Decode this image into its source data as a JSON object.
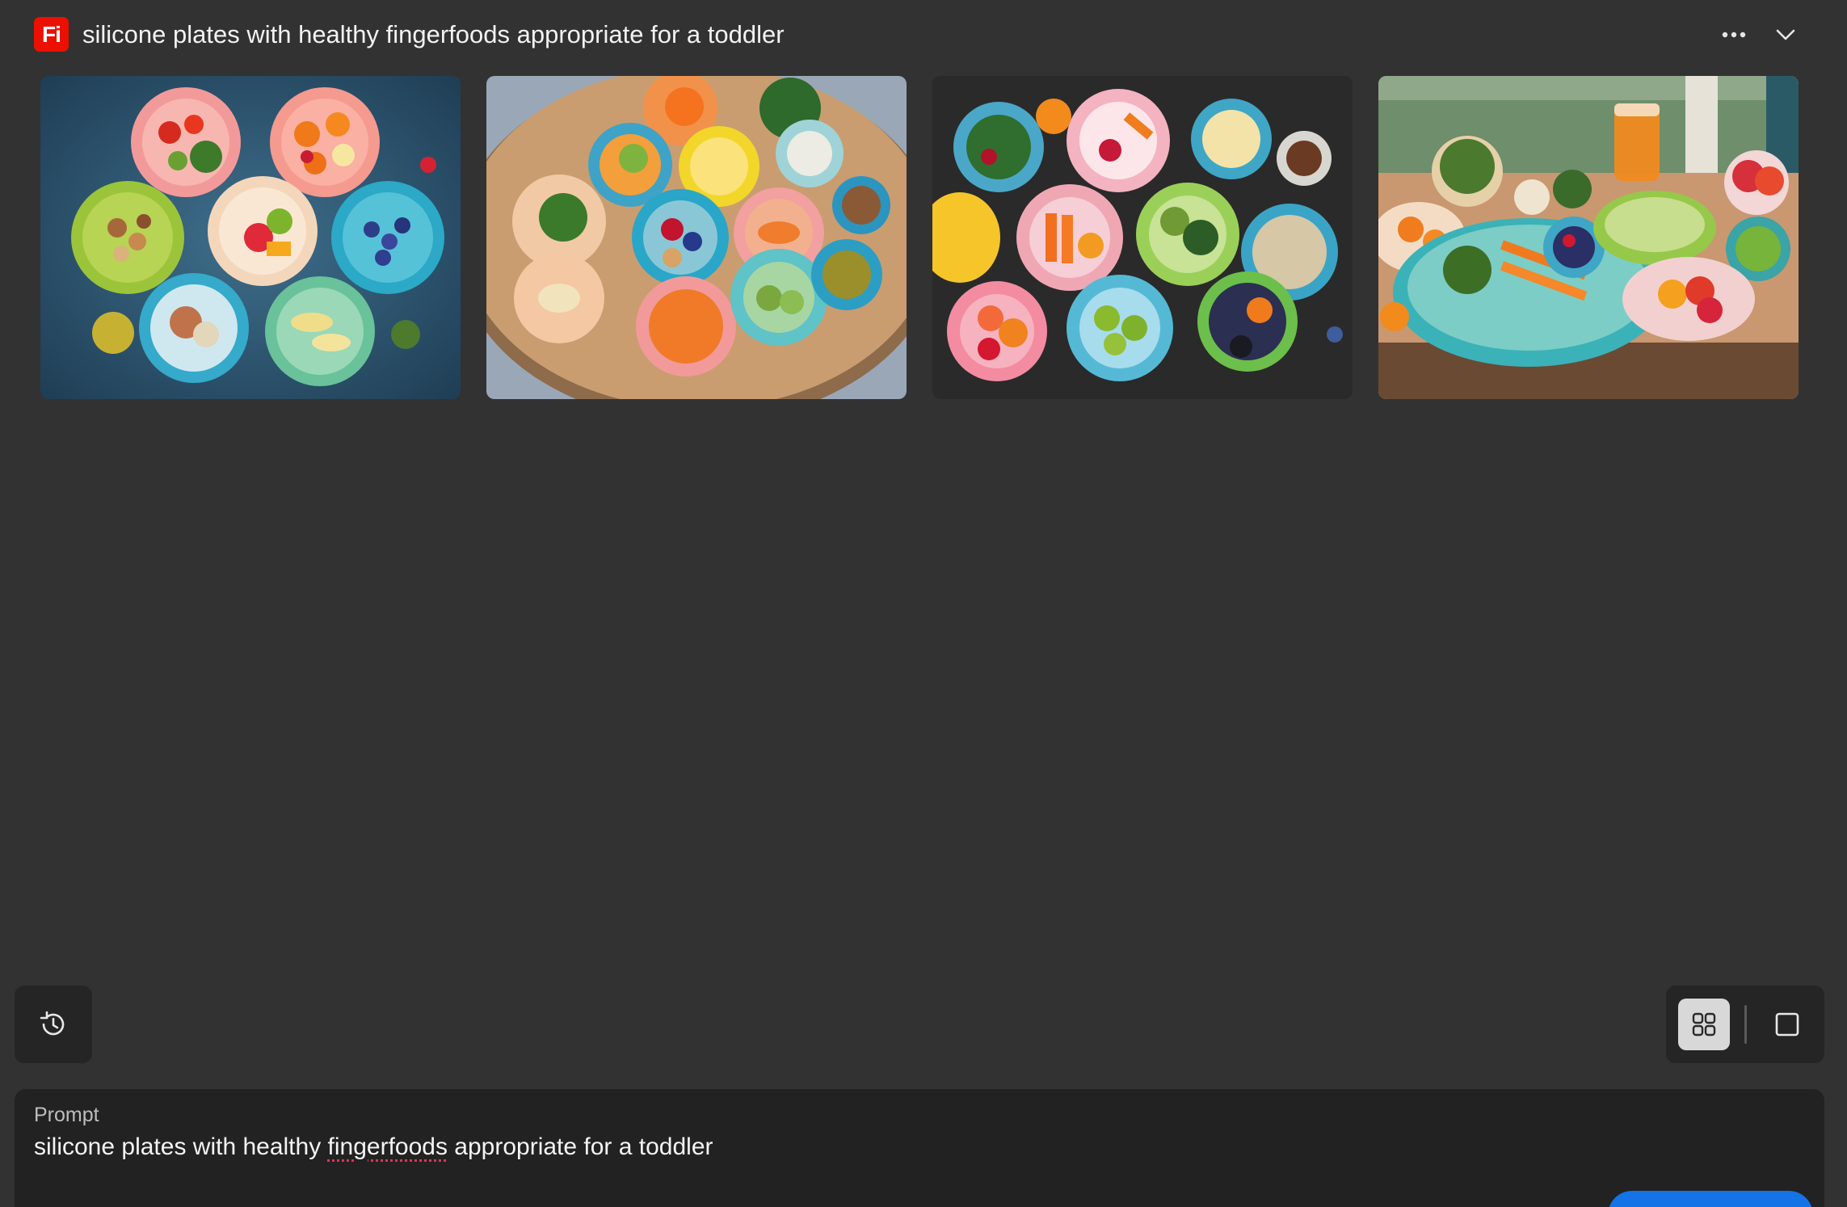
{
  "app": {
    "logo_text": "Fi",
    "title": "silicone plates with healthy fingerfoods appropriate for a toddler",
    "brand_color": "#eb1000"
  },
  "header": {
    "more_icon": "ellipsis-icon",
    "collapse_icon": "chevron-down-icon"
  },
  "results": {
    "images": [
      {
        "name": "result-image-1"
      },
      {
        "name": "result-image-2"
      },
      {
        "name": "result-image-3"
      },
      {
        "name": "result-image-4"
      }
    ]
  },
  "toolbar": {
    "history_icon": "history-icon",
    "view_grid_icon": "grid-view-icon",
    "view_single_icon": "single-view-icon",
    "active_view": "grid"
  },
  "prompt": {
    "label": "Prompt",
    "text_before": "silicone plates with healthy ",
    "text_misspelled": "fingerfoods",
    "text_after": " appropriate for a toddler",
    "accent_color": "#1473e6"
  }
}
